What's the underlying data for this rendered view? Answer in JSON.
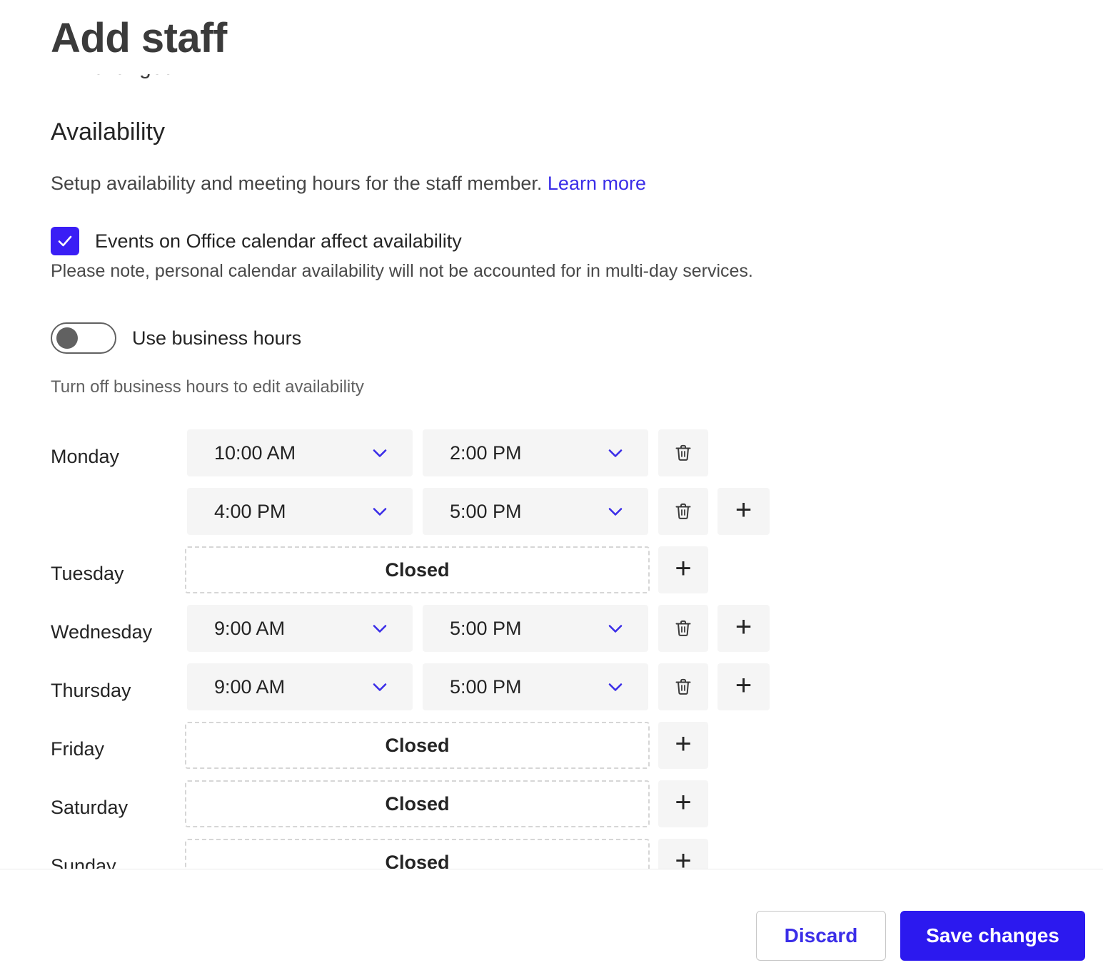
{
  "header": {
    "title": "Add staff",
    "ghost_text_behind_header": "changed"
  },
  "availability": {
    "section_title": "Availability",
    "description": "Setup availability and meeting hours for the staff member.",
    "learn_more_label": "Learn more",
    "office_calendar_checkbox": {
      "label": "Events on Office calendar affect availability",
      "checked": true,
      "icon": "checkmark-icon",
      "color": "#3a1ef5"
    },
    "office_calendar_note": "Please note, personal calendar availability will not be accounted for in multi-day services.",
    "business_hours_toggle": {
      "label": "Use business hours",
      "enabled": false,
      "hint": "Turn off business hours to edit availability"
    }
  },
  "schedule": {
    "closed_label": "Closed",
    "icons": {
      "delete": "trash-icon",
      "add": "plus-icon",
      "dropdown": "chevron-down-icon"
    },
    "days": [
      {
        "name": "Monday",
        "closed": false,
        "slots": [
          {
            "start": "10:00 AM",
            "end": "2:00 PM",
            "has_delete": true,
            "has_add": false
          },
          {
            "start": "4:00 PM",
            "end": "5:00 PM",
            "has_delete": true,
            "has_add": true
          }
        ]
      },
      {
        "name": "Tuesday",
        "closed": true,
        "slots": [
          {
            "start": "",
            "end": "",
            "has_delete": false,
            "has_add": true
          }
        ]
      },
      {
        "name": "Wednesday",
        "closed": false,
        "slots": [
          {
            "start": "9:00 AM",
            "end": "5:00 PM",
            "has_delete": true,
            "has_add": true
          }
        ]
      },
      {
        "name": "Thursday",
        "closed": false,
        "slots": [
          {
            "start": "9:00 AM",
            "end": "5:00 PM",
            "has_delete": true,
            "has_add": true
          }
        ]
      },
      {
        "name": "Friday",
        "closed": true,
        "slots": [
          {
            "start": "",
            "end": "",
            "has_delete": false,
            "has_add": true
          }
        ]
      },
      {
        "name": "Saturday",
        "closed": true,
        "slots": [
          {
            "start": "",
            "end": "",
            "has_delete": false,
            "has_add": true
          }
        ]
      },
      {
        "name": "Sunday",
        "closed": true,
        "slots": [
          {
            "start": "",
            "end": "",
            "has_delete": false,
            "has_add": true
          }
        ]
      }
    ]
  },
  "footer": {
    "discard_label": "Discard",
    "save_label": "Save changes",
    "accent_color": "#2c19ef"
  }
}
